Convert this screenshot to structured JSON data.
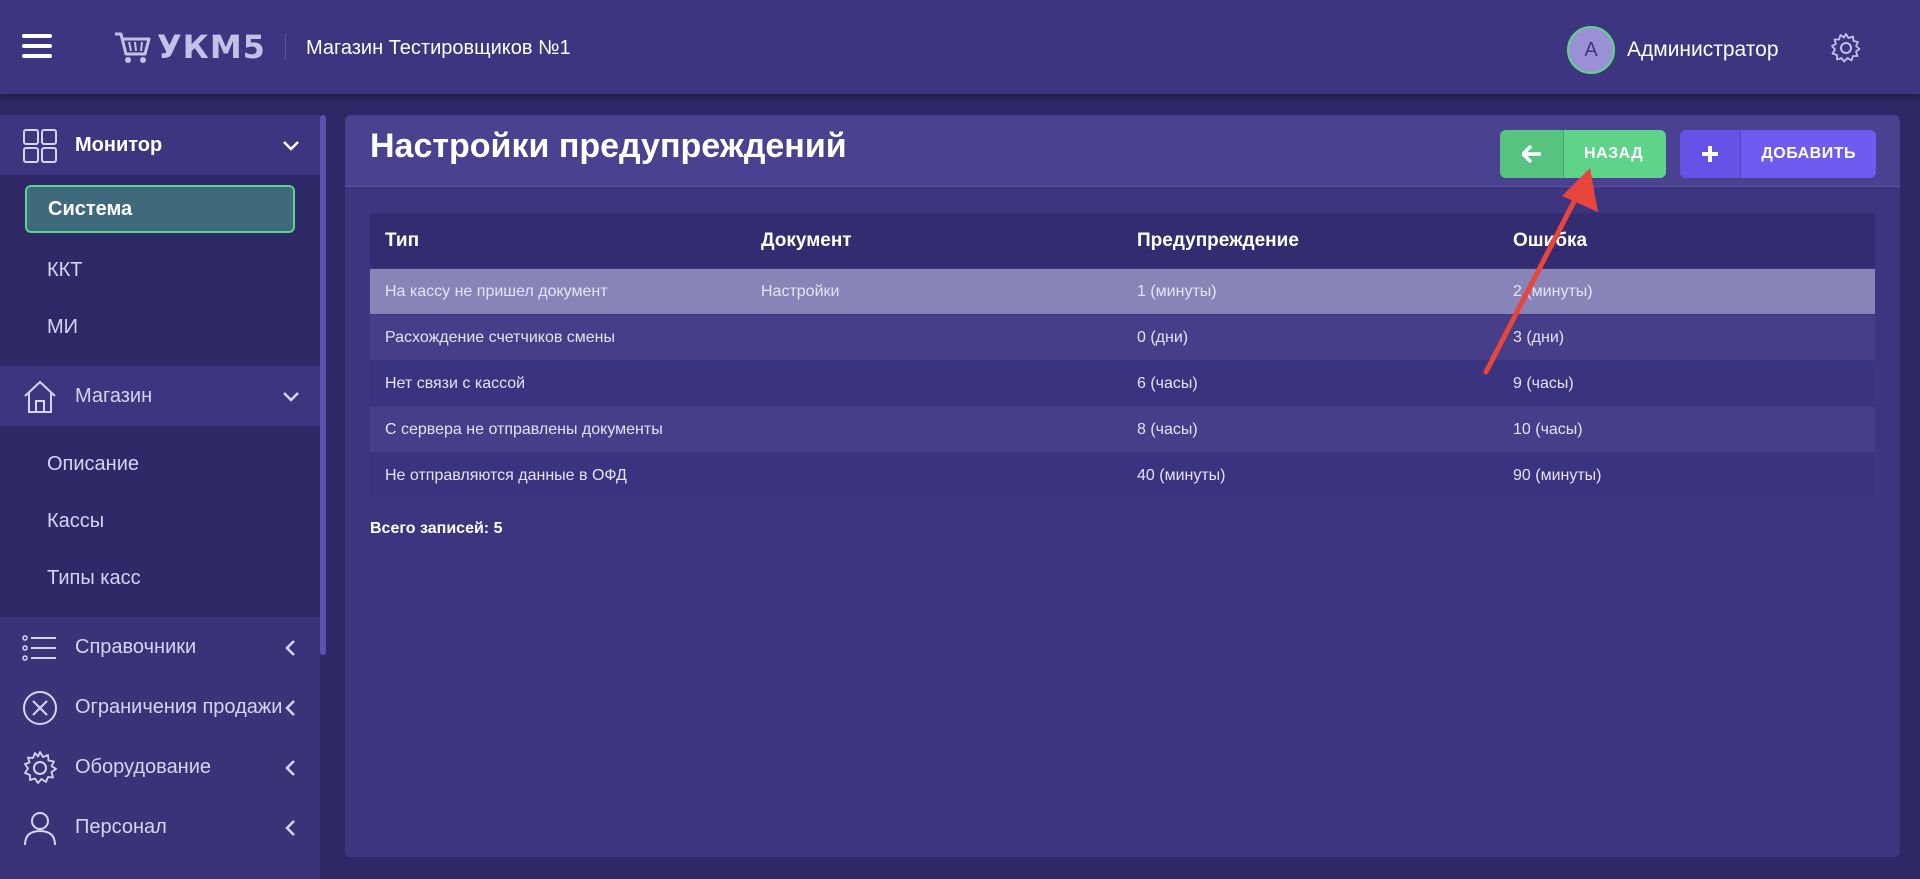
{
  "topbar": {
    "app_logo": "УКМ5",
    "store_name": "Магазин Тестировщиков №1",
    "avatar_letter": "А",
    "username": "Администратор"
  },
  "sidebar": {
    "sections": [
      {
        "label": "Монитор",
        "icon": "monitor-icon",
        "expanded": true,
        "items": [
          {
            "label": "Система",
            "selected": true
          },
          {
            "label": "ККТ"
          },
          {
            "label": "МИ"
          }
        ]
      },
      {
        "label": "Магазин",
        "icon": "home-icon",
        "expanded": true,
        "items": [
          {
            "label": "Описание"
          },
          {
            "label": "Кассы"
          },
          {
            "label": "Типы касс"
          }
        ]
      },
      {
        "label": "Справочники",
        "icon": "list-icon",
        "expanded": false
      },
      {
        "label": "Ограничения продажи",
        "icon": "restriction-icon",
        "expanded": false
      },
      {
        "label": "Оборудование",
        "icon": "gear-icon",
        "expanded": false
      },
      {
        "label": "Персонал",
        "icon": "user-icon",
        "expanded": false
      }
    ]
  },
  "main": {
    "title": "Настройки предупреждений",
    "back_label": "НАЗАД",
    "add_label": "ДОБАВИТЬ",
    "columns": [
      "Тип",
      "Документ",
      "Предупреждение",
      "Ошибка"
    ],
    "rows": [
      [
        "На кассу не пришел документ",
        "Настройки",
        "1 (минуты)",
        "2 (минуты)"
      ],
      [
        "Расхождение счетчиков смены",
        "",
        "0 (дни)",
        "3 (дни)"
      ],
      [
        "Нет связи с кассой",
        "",
        "6 (часы)",
        "9 (часы)"
      ],
      [
        "С сервера не отправлены документы",
        "",
        "8 (часы)",
        "10 (часы)"
      ],
      [
        "Не отправляются данные в ОФД",
        "",
        "40 (минуты)",
        "90 (минуты)"
      ]
    ],
    "total": "Всего записей: 5"
  },
  "colors": {
    "background": "#2e2866",
    "panel": "#3d3580",
    "accent_green": "#5fd38a",
    "accent_purple": "#6e5cf0",
    "annotation_arrow": "#e8453c"
  }
}
